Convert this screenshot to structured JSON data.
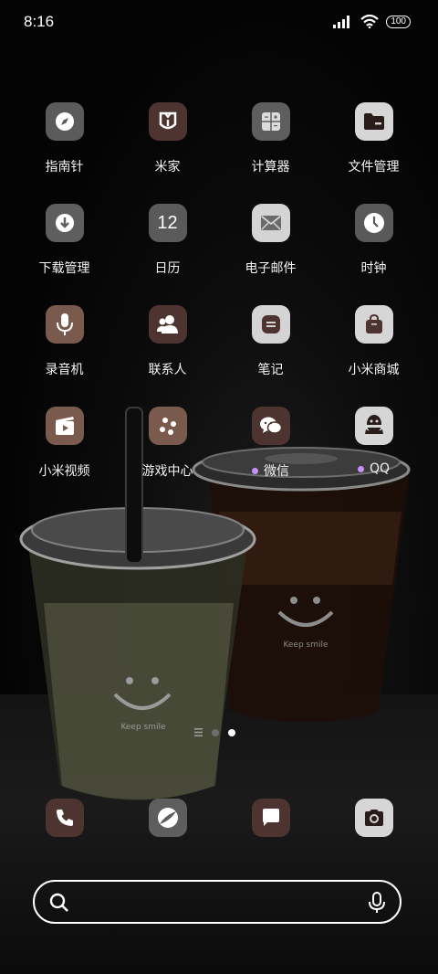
{
  "status_bar": {
    "time": "8:16",
    "battery": "100"
  },
  "apps": [
    {
      "label": "指南针",
      "icon": "compass-icon",
      "bg": "#5b5b5b"
    },
    {
      "label": "米家",
      "icon": "mijia-icon",
      "bg": "#4e3430"
    },
    {
      "label": "计算器",
      "icon": "calculator-icon",
      "bg": "#5e5e5e"
    },
    {
      "label": "文件管理",
      "icon": "folder-icon",
      "bg": "#d6d6d6"
    },
    {
      "label": "下载管理",
      "icon": "download-icon",
      "bg": "#5e5e5e"
    },
    {
      "label": "日历",
      "icon": "calendar-icon",
      "bg": "#5a5a5a",
      "glyph": "12"
    },
    {
      "label": "电子邮件",
      "icon": "mail-icon",
      "bg": "#d4d4d4"
    },
    {
      "label": "时钟",
      "icon": "clock-icon",
      "bg": "#595959"
    },
    {
      "label": "录音机",
      "icon": "microphone-icon",
      "bg": "#7a5a4c"
    },
    {
      "label": "联系人",
      "icon": "contacts-icon",
      "bg": "#4e3430"
    },
    {
      "label": "笔记",
      "icon": "notes-icon",
      "bg": "#d4d4d4"
    },
    {
      "label": "小米商城",
      "icon": "shopping-bag-icon",
      "bg": "#d6d6d6"
    },
    {
      "label": "小米视频",
      "icon": "video-icon",
      "bg": "#7a5a4c"
    },
    {
      "label": "游戏中心",
      "icon": "game-icon",
      "bg": "#7a5a4c"
    },
    {
      "label": "微信",
      "icon": "wechat-icon",
      "bg": "#4e3430",
      "new_dot": true
    },
    {
      "label": "QQ",
      "icon": "qq-icon",
      "bg": "#d6d6d6",
      "new_dot": true
    }
  ],
  "dock": [
    {
      "icon": "phone-icon",
      "bg": "#4e3430"
    },
    {
      "icon": "browser-icon",
      "bg": "#5e5e5e"
    },
    {
      "icon": "message-icon",
      "bg": "#4e3430"
    },
    {
      "icon": "camera-icon",
      "bg": "#d6d6d6"
    }
  ],
  "wallpaper": {
    "cup_text_left": "Keep smile",
    "cup_text_right": "Keep smile"
  },
  "colors": {
    "new_dot": "#c690ff"
  }
}
